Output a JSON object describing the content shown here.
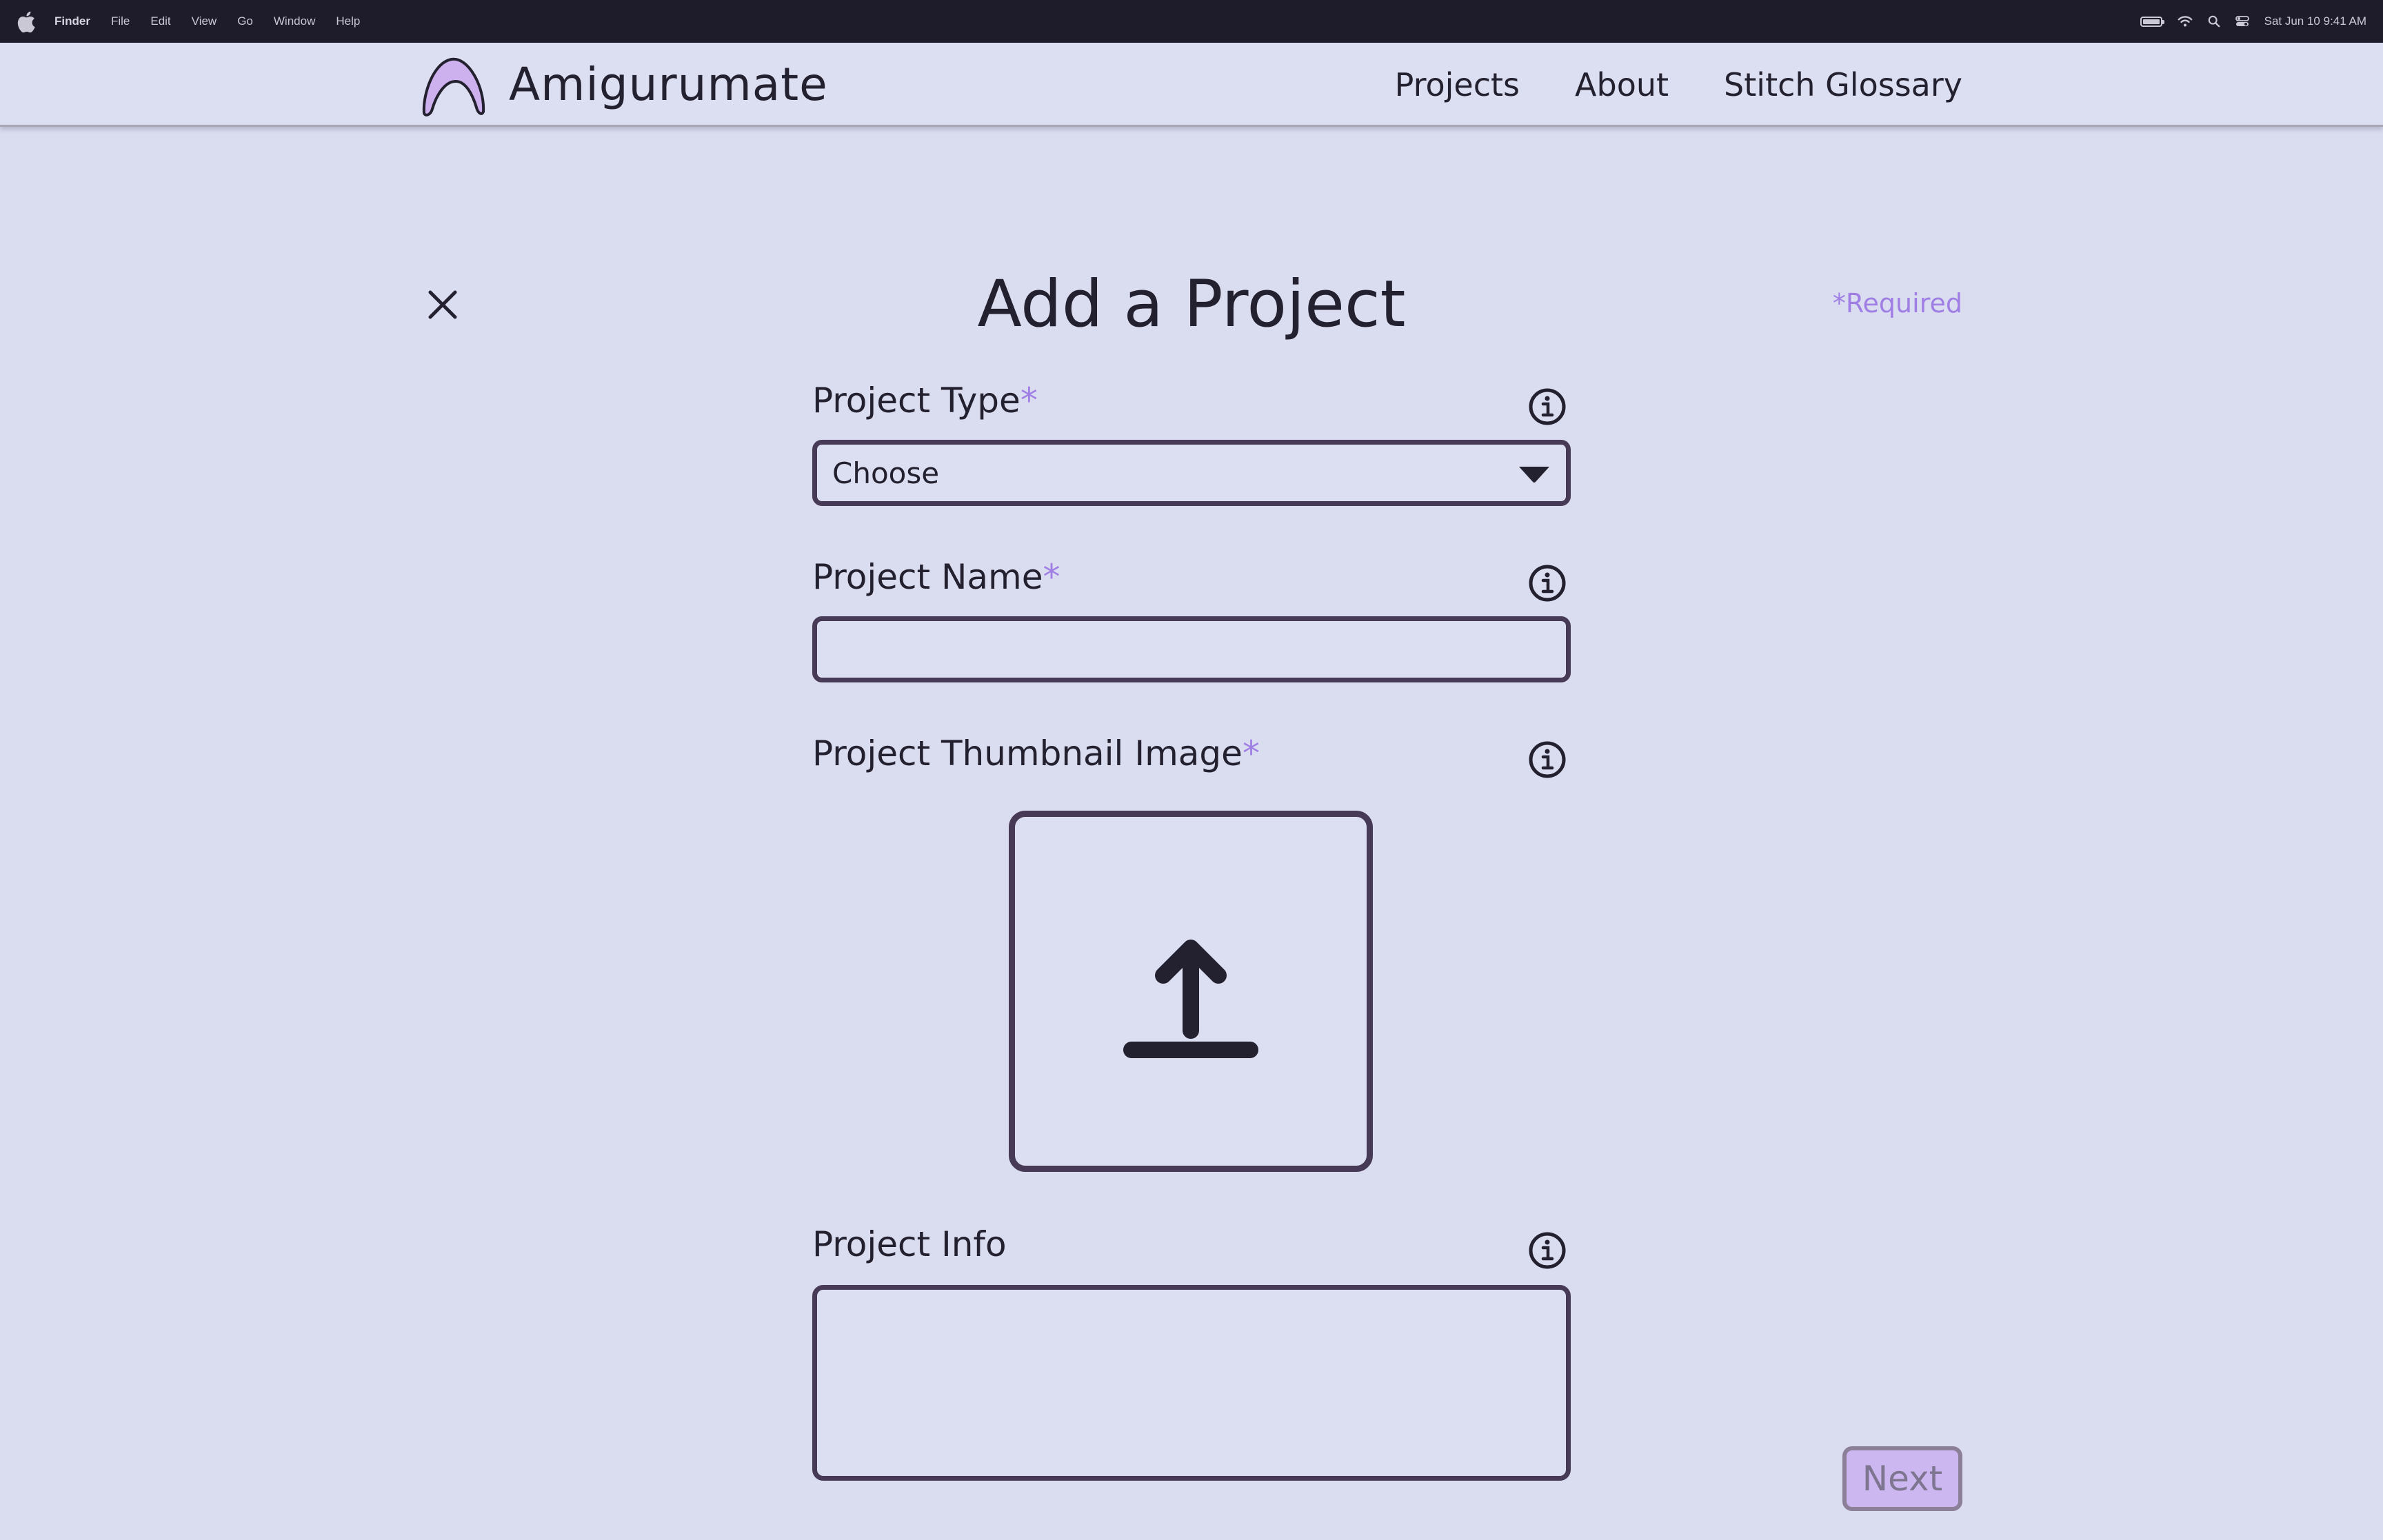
{
  "menubar": {
    "app_name": "Finder",
    "items": [
      "File",
      "Edit",
      "View",
      "Go",
      "Window",
      "Help"
    ],
    "datetime": "Sat Jun 10  9:41 AM"
  },
  "header": {
    "brand": "Amigurumate",
    "nav": [
      "Projects",
      "About",
      "Stitch Glossary"
    ]
  },
  "form": {
    "title": "Add a Project",
    "required_note": "*Required",
    "project_type": {
      "label": "Project Type",
      "required_mark": "*",
      "selected": "Choose"
    },
    "project_name": {
      "label": "Project Name",
      "required_mark": "*",
      "value": ""
    },
    "thumbnail": {
      "label": "Project Thumbnail Image",
      "required_mark": "*"
    },
    "project_info": {
      "label": "Project Info",
      "value": ""
    },
    "next_label": "Next"
  },
  "colors": {
    "background": "#dadcf0",
    "accent": "#a07fe4",
    "border": "#473a57",
    "text": "#23212f",
    "button_fill": "#cdb7f1"
  }
}
